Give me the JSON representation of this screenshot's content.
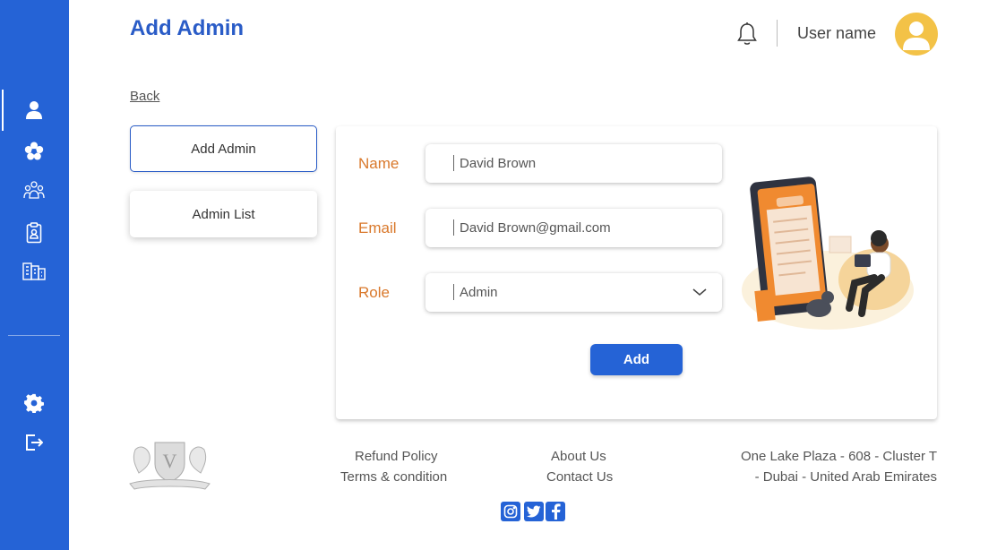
{
  "page": {
    "title": "Add Admin"
  },
  "header": {
    "user_name": "User name"
  },
  "nav": {
    "back_label": "Back"
  },
  "menu": {
    "add_admin": "Add Admin",
    "admin_list": "Admin List"
  },
  "form": {
    "name_label": "Name",
    "name_value": "David Brown",
    "email_label": "Email",
    "email_value": "David Brown@gmail.com",
    "role_label": "Role",
    "role_value": "Admin",
    "submit_label": "Add"
  },
  "footer": {
    "refund_policy": "Refund Policy",
    "terms": "Terms & condition",
    "about_us": "About Us",
    "contact_us": "Contact Us",
    "address_line1": "One Lake Plaza - 608 - Cluster T",
    "address_line2": "- Dubai - United Arab Emirates"
  },
  "colors": {
    "primary": "#2563d6",
    "title": "#2a5cc7",
    "label": "#d9782b",
    "avatar": "#f3c247"
  },
  "icons": {
    "sidebar": [
      "user-icon",
      "flower-settings-icon",
      "group-icon",
      "clipboard-badge-icon",
      "buildings-icon",
      "settings-icon",
      "logout-icon"
    ],
    "header": [
      "bell-icon",
      "avatar-icon"
    ],
    "social": [
      "instagram-icon",
      "twitter-icon",
      "facebook-icon"
    ]
  }
}
